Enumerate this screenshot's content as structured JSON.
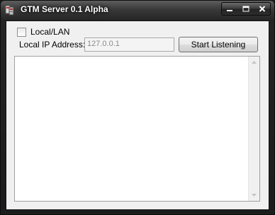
{
  "window": {
    "title": "GTM Server 0.1 Alpha",
    "icon": "app-icon"
  },
  "titlebar_buttons": {
    "minimize_icon": "minimize-icon",
    "maximize_icon": "maximize-icon",
    "close_icon": "close-icon"
  },
  "form": {
    "local_lan_label": "Local/LAN",
    "local_lan_checked": false,
    "ip_label": "Local IP Address:",
    "ip_value": "127.0.0.1",
    "start_button_label": "Start Listening"
  },
  "log": {
    "content": ""
  },
  "colors": {
    "client_background": "#f0f0f0",
    "title_text": "#ffffff",
    "disabled_text": "#8a8a8a"
  }
}
